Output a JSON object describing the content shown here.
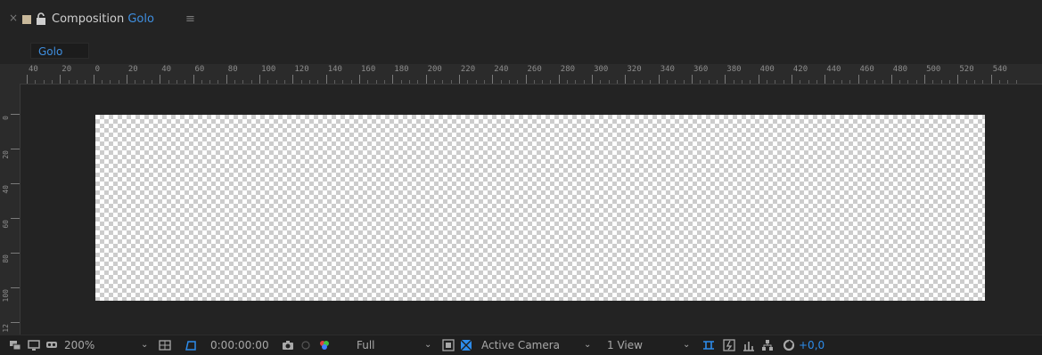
{
  "header": {
    "close_glyph": "×",
    "composition_label": "Composition",
    "composition_name": "Golo",
    "menu_glyph": "≡",
    "swatch_color": "#c8b89a",
    "accent_color": "#3f8fe0"
  },
  "subtab": {
    "label": "Golo"
  },
  "ruler": {
    "h_labels": [
      "40",
      "20",
      "0",
      "20",
      "40",
      "60",
      "80",
      "100",
      "120",
      "140",
      "160",
      "180",
      "200",
      "220",
      "240",
      "260",
      "280",
      "300",
      "320",
      "340",
      "360",
      "380",
      "400",
      "420",
      "440",
      "460",
      "480",
      "500",
      "520",
      "540"
    ],
    "v_labels": [
      "0",
      "2\n0",
      "4\n0",
      "6\n0",
      "8\n0",
      "1\n0\n0",
      "1\n2"
    ]
  },
  "toolbar": {
    "zoom": "200%",
    "timecode": "0:00:00:00",
    "resolution": "Full",
    "camera": "Active Camera",
    "views": "1 View",
    "exposure": "+0,0"
  }
}
